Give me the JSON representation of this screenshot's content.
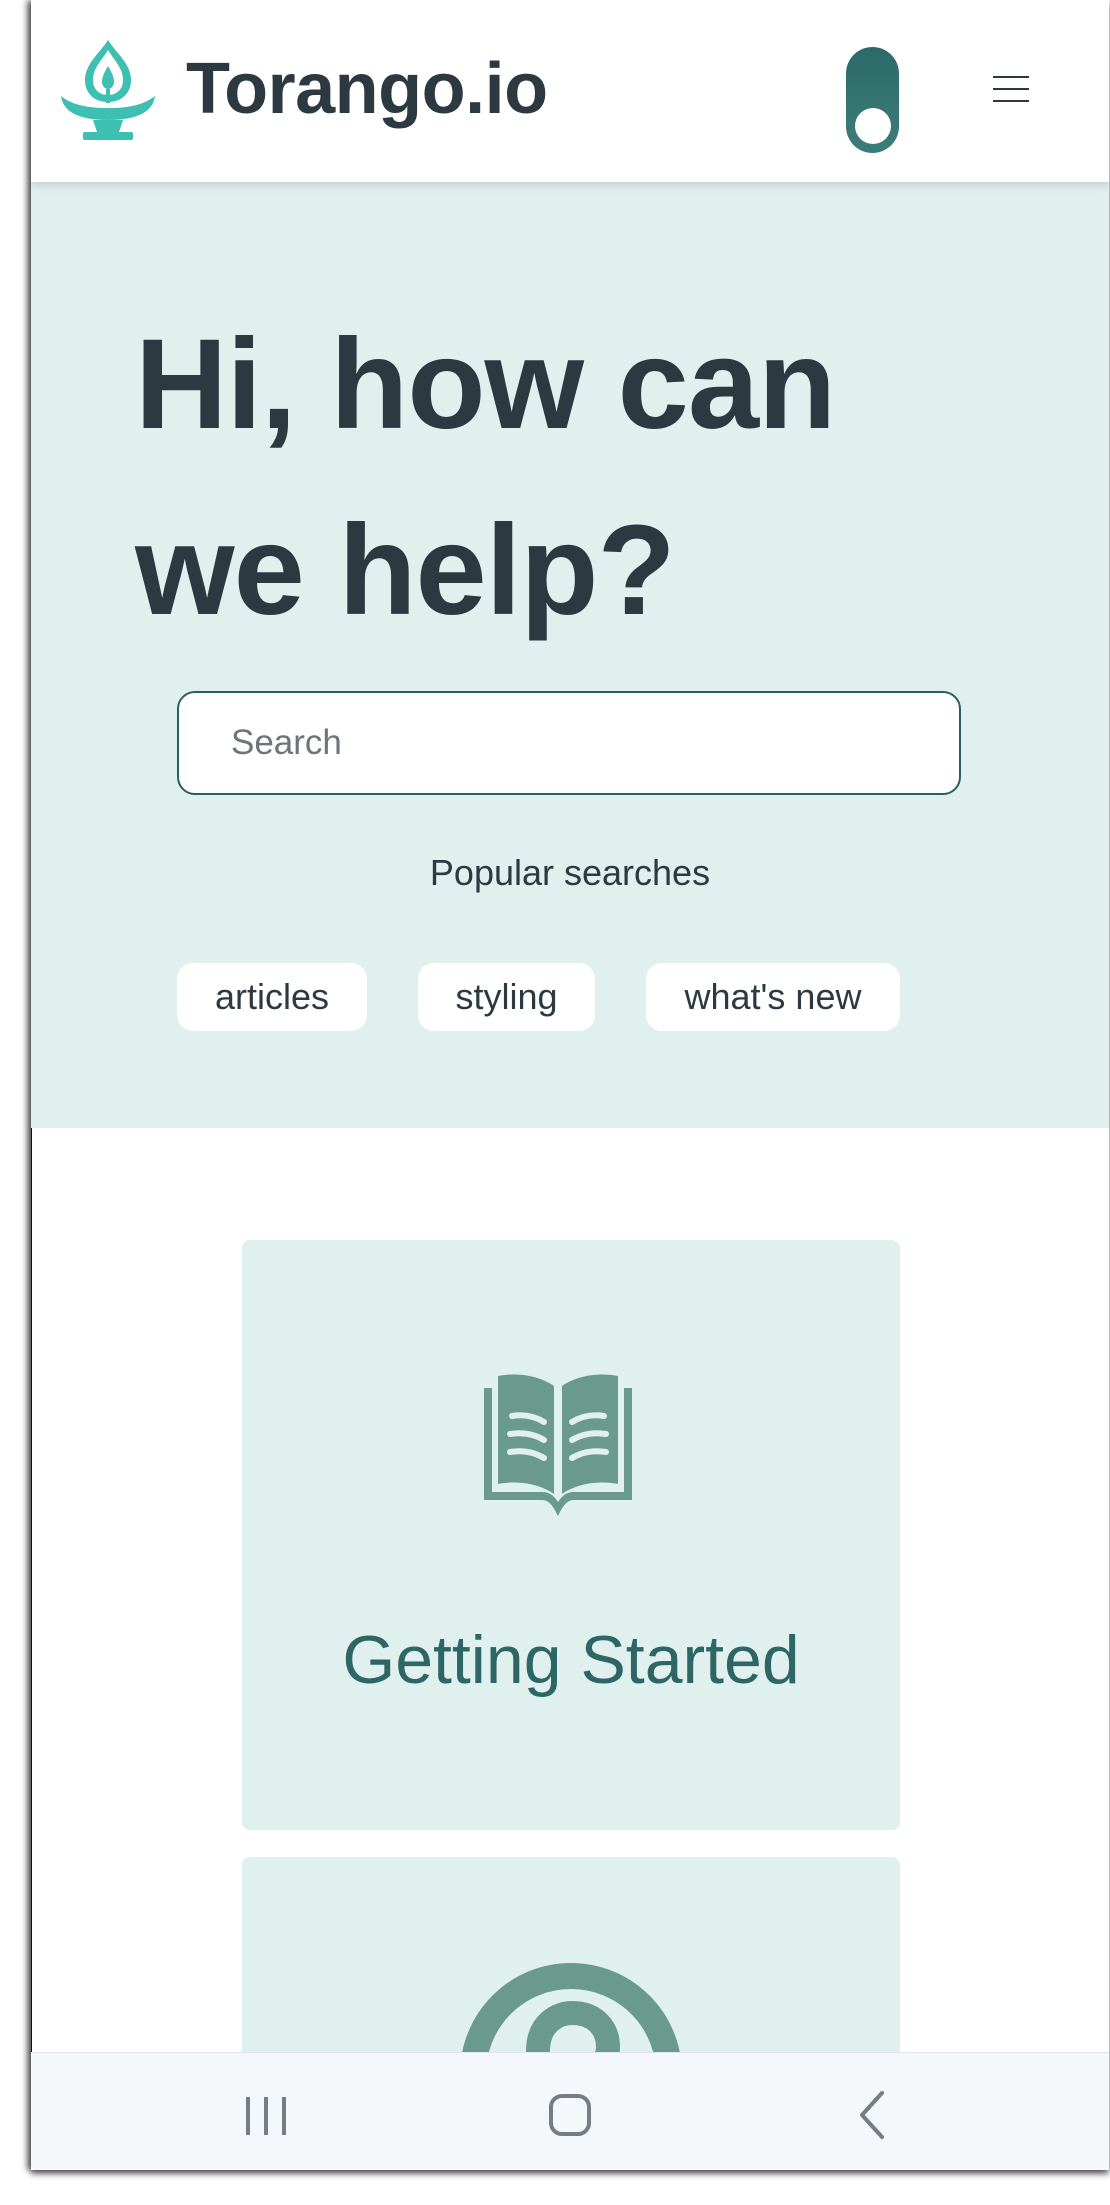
{
  "header": {
    "brand": "Torango.io",
    "logo_icon": "oil-lamp-icon",
    "theme_toggle_icon": "toggle-switch",
    "menu_icon": "hamburger-menu-icon"
  },
  "hero": {
    "title": "Hi, how can we help?",
    "search": {
      "placeholder": "Search",
      "value": ""
    },
    "popular_label": "Popular searches",
    "chips": [
      "articles",
      "styling",
      "what's new"
    ]
  },
  "cards": [
    {
      "title": "Getting Started",
      "icon": "open-book-icon"
    },
    {
      "title": "",
      "icon": "help-circle-icon"
    }
  ],
  "navbar": {
    "icons": [
      "recent-apps-icon",
      "home-icon",
      "back-icon"
    ]
  },
  "colors": {
    "brand_teal": "#3dbfb2",
    "accent_dark_teal": "#2d6664",
    "hero_background": "#e0f0ef",
    "text_dark": "#2c3941",
    "icon_teal": "#6a9a8d"
  }
}
